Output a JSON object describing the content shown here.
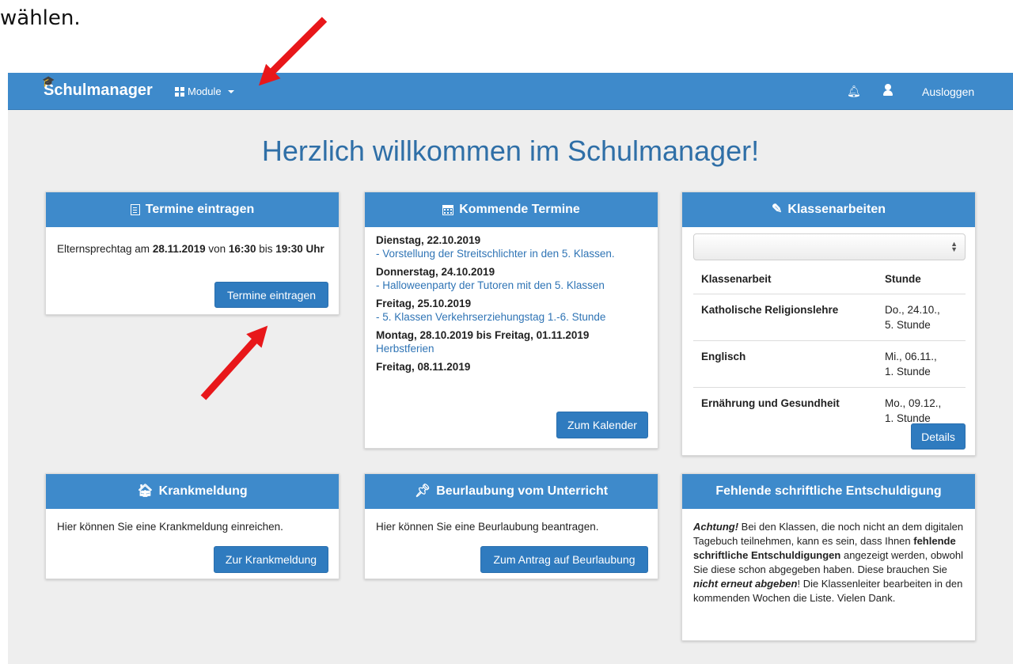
{
  "doc_text": "wählen.",
  "nav": {
    "brand": "Schulmanager",
    "modules": "Module",
    "logout": "Ausloggen"
  },
  "welcome": "Herzlich willkommen im Schulmanager!",
  "termine_eintragen": {
    "title": "Termine eintragen",
    "text_prefix": "Elternsprechtag am ",
    "date": "28.11.2019",
    "von": " von ",
    "start": "16:30",
    "bis": " bis ",
    "end": "19:30 Uhr",
    "button": "Termine eintragen"
  },
  "kommende_termine": {
    "title": "Kommende Termine",
    "events": [
      {
        "date": "Dienstag, 22.10.2019",
        "text": "- Vorstellung der Streitschlichter in den 5. Klassen."
      },
      {
        "date": "Donnerstag, 24.10.2019",
        "text": "- Halloweenparty der Tutoren mit den 5. Klassen"
      },
      {
        "date": "Freitag, 25.10.2019",
        "text": "- 5. Klassen Verkehrserziehungstag 1.-6. Stunde"
      },
      {
        "date": "Montag, 28.10.2019 bis Freitag, 01.11.2019",
        "text": "Herbstferien"
      },
      {
        "date": "Freitag, 08.11.2019",
        "text": ""
      }
    ],
    "button": "Zum Kalender"
  },
  "klassenarbeiten": {
    "title": "Klassenarbeiten",
    "col_subject": "Klassenarbeit",
    "col_time": "Stunde",
    "rows": [
      {
        "subject": "Katholische Religionslehre",
        "date": "Do., 24.10.,",
        "lesson": "5. Stunde"
      },
      {
        "subject": "Englisch",
        "date": "Mi., 06.11.,",
        "lesson": "1. Stunde"
      },
      {
        "subject": "Ernährung und Gesundheit",
        "date": "Mo., 09.12.,",
        "lesson": "1. Stunde"
      }
    ],
    "button": "Details"
  },
  "krankmeldung": {
    "title": "Krankmeldung",
    "text": "Hier können Sie eine Krankmeldung einreichen.",
    "button": "Zur Krankmeldung"
  },
  "beurlaubung": {
    "title": "Beurlaubung vom Unterricht",
    "text": "Hier können Sie eine Beurlaubung beantragen.",
    "button": "Zum Antrag auf Beurlaubung"
  },
  "entschuldigung": {
    "title": "Fehlende schriftliche Entschuldigung",
    "achtung": "Achtung!",
    "t1": " Bei den Klassen, die noch nicht an dem digitalen Tagebuch teilnehmen, kann es sein, dass Ihnen ",
    "bold1": "fehlende schriftliche Entschuldigungen",
    "t2": " angezeigt werden, obwohl Sie diese schon abgegeben haben. Diese brauchen Sie ",
    "bold2": "nicht erneut abgeben",
    "t3": "! Die Klassenleiter bearbeiten in den kommenden Wochen die Liste. Vielen Dank."
  },
  "colors": {
    "primary": "#3e8acb",
    "button": "#2f7bbf",
    "link": "#2f74b5",
    "arrow": "#e8171a"
  }
}
